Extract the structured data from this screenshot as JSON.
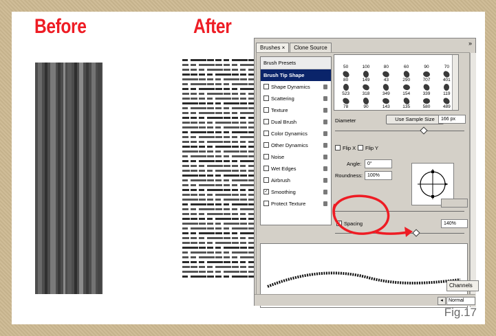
{
  "headings": {
    "before": "Before",
    "after": "After"
  },
  "figure_label": "Fig.17",
  "panel": {
    "tabs": [
      "Brushes ×",
      "Clone Source"
    ],
    "close_symbol": "»",
    "list": {
      "header": "Brush Presets",
      "items": [
        {
          "label": "Brush Tip Shape",
          "checked": false,
          "selected": true,
          "lock": false
        },
        {
          "label": "Shape Dynamics",
          "checked": false,
          "selected": false,
          "lock": true
        },
        {
          "label": "Scattering",
          "checked": false,
          "selected": false,
          "lock": true
        },
        {
          "label": "Texture",
          "checked": false,
          "selected": false,
          "lock": true
        },
        {
          "label": "Dual Brush",
          "checked": false,
          "selected": false,
          "lock": true
        },
        {
          "label": "Color Dynamics",
          "checked": false,
          "selected": false,
          "lock": true
        },
        {
          "label": "Other Dynamics",
          "checked": false,
          "selected": false,
          "lock": true
        },
        {
          "label": "Noise",
          "checked": false,
          "selected": false,
          "lock": true
        },
        {
          "label": "Wet Edges",
          "checked": false,
          "selected": false,
          "lock": true
        },
        {
          "label": "Airbrush",
          "checked": false,
          "selected": false,
          "lock": true
        },
        {
          "label": "Smoothing",
          "checked": true,
          "selected": false,
          "lock": true
        },
        {
          "label": "Protect Texture",
          "checked": false,
          "selected": false,
          "lock": true
        }
      ]
    },
    "presets": {
      "sizes": [
        "50",
        "100",
        "80",
        "60",
        "90",
        "70",
        "80",
        "149",
        "43",
        "290",
        "707",
        "401",
        "523",
        "318",
        "349",
        "154",
        "339",
        "119",
        "78",
        "90",
        "143",
        "135",
        "580",
        "489"
      ]
    },
    "diameter": {
      "label": "Diameter",
      "button": "Use Sample Size",
      "value": "166 px"
    },
    "flip_x": "Flip X",
    "flip_y": "Flip Y",
    "angle": {
      "label": "Angle:",
      "value": "0°"
    },
    "roundness": {
      "label": "Roundness:",
      "value": "100%"
    },
    "spacing": {
      "label": "Spacing",
      "checked": true,
      "value": "140%"
    },
    "channels_tab": "Channels",
    "blend_mode": "Normal"
  }
}
